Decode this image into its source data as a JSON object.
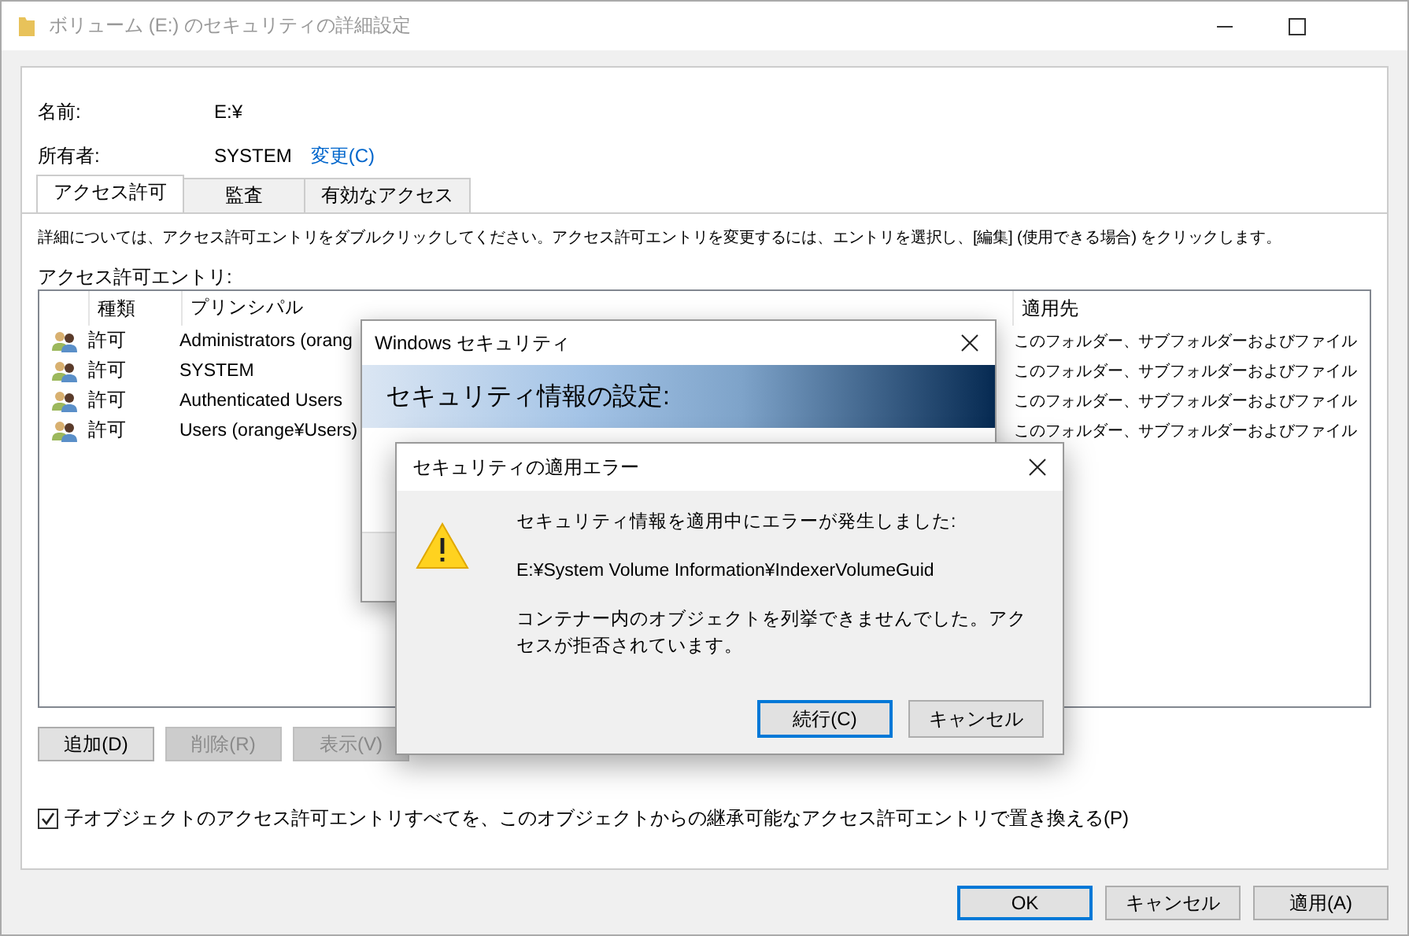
{
  "window": {
    "title": "ボリューム (E:) のセキュリティの詳細設定"
  },
  "fields": [
    {
      "label": "名前:",
      "value": "E:¥"
    },
    {
      "label": "所有者:",
      "value": "SYSTEM",
      "link": "変更(C)"
    }
  ],
  "tabs": [
    {
      "label": "アクセス許可",
      "selected": true
    },
    {
      "label": "監査",
      "selected": false
    },
    {
      "label": "有効なアクセス",
      "selected": false
    }
  ],
  "description": "詳細については、アクセス許可エントリをダブルクリックしてください。アクセス許可エントリを変更するには、エントリを選択し、[編集] (使用できる場合) をクリックします。",
  "entries_label": "アクセス許可エントリ:",
  "columns": [
    "種類",
    "プリンシパル",
    "適用先"
  ],
  "entries": [
    {
      "type": "許可",
      "principal": "Administrators (orang",
      "applies_to": "このフォルダー、サブフォルダーおよびファイル"
    },
    {
      "type": "許可",
      "principal": "SYSTEM",
      "applies_to": "このフォルダー、サブフォルダーおよびファイル"
    },
    {
      "type": "許可",
      "principal": "Authenticated Users",
      "applies_to": "このフォルダー、サブフォルダーおよびファイル"
    },
    {
      "type": "許可",
      "principal": "Users (orange¥Users)",
      "applies_to": "このフォルダー、サブフォルダーおよびファイル"
    }
  ],
  "list_buttons": [
    {
      "label": "追加(D)",
      "disabled": false
    },
    {
      "label": "削除(R)",
      "disabled": true
    },
    {
      "label": "表示(V)",
      "disabled": true
    }
  ],
  "replace_checkbox": {
    "label": "子オブジェクトのアクセス許可エントリすべてを、このオブジェクトからの継承可能なアクセス許可エントリで置き換える(P)",
    "checked": true
  },
  "buttons": [
    {
      "label": "OK",
      "default": true
    },
    {
      "label": "キャンセル",
      "default": false
    },
    {
      "label": "適用(A)",
      "default": false
    }
  ],
  "security_dialog": {
    "title": "Windows セキュリティ",
    "heading": "セキュリティ情報の設定:"
  },
  "error_dialog": {
    "title": "セキュリティの適用エラー",
    "message": "セキュリティ情報を適用中にエラーが発生しました:",
    "path": "E:¥System Volume Information¥IndexerVolumeGuid",
    "detail": "コンテナー内のオブジェクトを列挙できませんでした。アクセスが拒否されています。",
    "buttons": [
      {
        "label": "続行(C)",
        "default": true
      },
      {
        "label": "キャンセル",
        "default": false
      }
    ]
  }
}
